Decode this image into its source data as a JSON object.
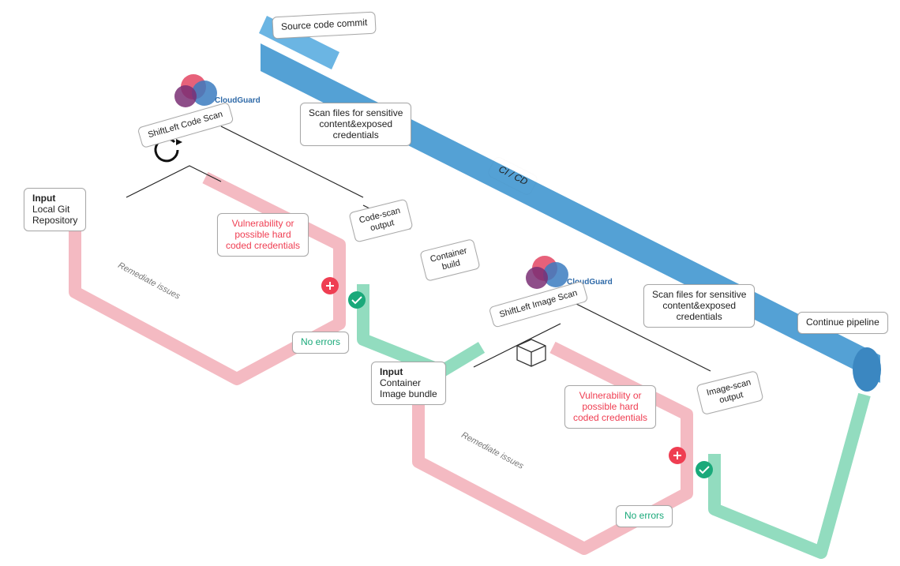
{
  "pipeline": {
    "source_commit": "Source code commit",
    "cicd": "CI / CD",
    "continue": "Continue pipeline"
  },
  "inputs": {
    "git": {
      "title": "Input",
      "body": "Local Git\nRepository"
    },
    "image": {
      "title": "Input",
      "body": "Container\nImage bundle"
    }
  },
  "scan1": {
    "product": "CloudGuard",
    "step": "ShiftLeft Code Scan",
    "scan_desc": "Scan files for sensitive\ncontent&exposed\ncredentials",
    "output": "Code-scan\noutput",
    "vuln": "Vulnerability or\npossible hard\ncoded credentials",
    "no_errors": "No errors",
    "remediate": "Remediate issues"
  },
  "build": {
    "container_build": "Container\nbuild"
  },
  "scan2": {
    "product": "CloudGuard",
    "step": "ShiftLeft Image Scan",
    "scan_desc": "Scan files for sensitive\ncontent&exposed\ncredentials",
    "output": "Image-scan\noutput",
    "vuln": "Vulnerability or\npossible hard\ncoded credentials",
    "no_errors": "No errors",
    "remediate": "Remediate issues"
  },
  "colors": {
    "blue": "#3b92cf",
    "pink": "#f5a9b4",
    "red": "#ef3e52",
    "green": "#33b18a",
    "grey": "#8a8a8a"
  }
}
